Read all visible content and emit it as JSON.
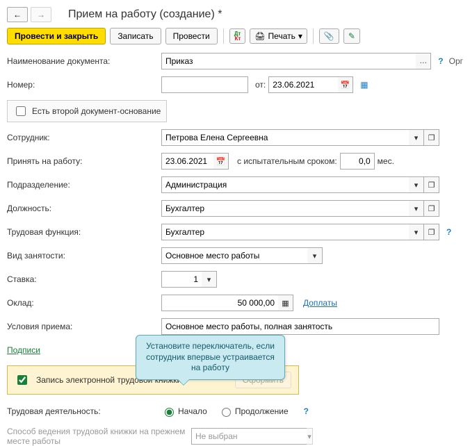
{
  "nav": {
    "back": "←",
    "forward": "→"
  },
  "title": "Прием на работу (создание) *",
  "toolbar": {
    "post_close": "Провести и закрыть",
    "write": "Записать",
    "post": "Провести",
    "print": "Печать",
    "print_arrow": "▾",
    "attach": "📎",
    "sign": "✎"
  },
  "labels": {
    "doc_name": "Наименование документа:",
    "number": "Номер:",
    "from": "от:",
    "has_second_base": "Есть второй документ-основание",
    "employee": "Сотрудник:",
    "hire_on": "Принять на работу:",
    "probation": "с испытательным сроком:",
    "months": "мес.",
    "department": "Подразделение:",
    "position": "Должность:",
    "labor_function": "Трудовая функция:",
    "employment_type": "Вид занятости:",
    "rate": "Ставка:",
    "salary": "Оклад:",
    "allowances": "Доплаты",
    "hire_conditions": "Условия приема:",
    "signatures": "Подписи",
    "etk_record": "Запись электронной трудовой книжки",
    "etk_hidden_btn": "Оформить",
    "labor_activity": "Трудовая деятельность:",
    "radio_start": "Начало",
    "radio_continue": "Продолжение",
    "prev_book_method": "Способ ведения трудовой книжки на прежнем месте работы",
    "org_cut": "Орг"
  },
  "values": {
    "doc_name": "Приказ",
    "number": "",
    "date": "23.06.2021",
    "employee": "Петрова Елена Сергеевна",
    "hire_date": "23.06.2021",
    "probation": "0,0",
    "department": "Администрация",
    "position": "Бухгалтер",
    "labor_function": "Бухгалтер",
    "employment_type": "Основное место работы",
    "rate": "1",
    "salary": "50 000,00",
    "hire_conditions": "Основное место работы, полная занятость",
    "prev_method": "Не выбран"
  },
  "icons": {
    "ellipsis": "…",
    "calendar": "📅",
    "list": "▦",
    "dropdown": "▾",
    "open": "❐",
    "printer": "🖨",
    "spin": "▸",
    "help": "?"
  },
  "callout": "Установите переключатель, если сотрудник впервые устраивается на работу"
}
